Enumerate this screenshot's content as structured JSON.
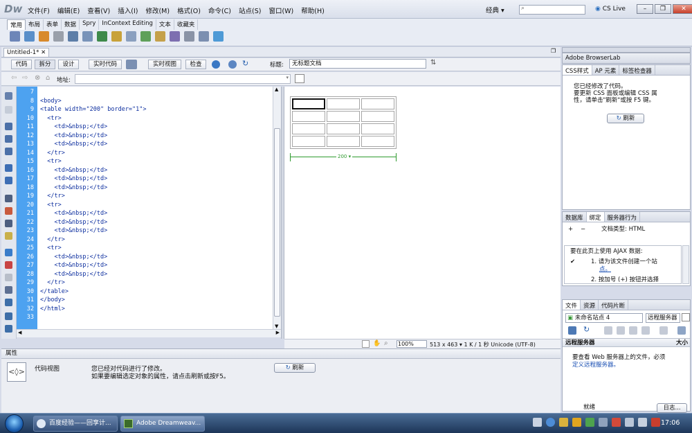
{
  "app": {
    "logo": "Dw",
    "menus": [
      "文件(F)",
      "编辑(E)",
      "查看(V)",
      "插入(I)",
      "修改(M)",
      "格式(O)",
      "命令(C)",
      "站点(S)",
      "窗口(W)",
      "帮助(H)"
    ],
    "workspace": "经典 ▾",
    "cslive": "CS Live"
  },
  "insert": {
    "tabs": [
      "常用",
      "布局",
      "表单",
      "数据",
      "Spry",
      "InContext Editing",
      "文本",
      "收藏夹"
    ]
  },
  "doc": {
    "tab": "Untitled-1*",
    "buttons": [
      "代码",
      "拆分",
      "设计",
      "实时代码",
      "实时视图",
      "检查"
    ],
    "title_label": "标题:",
    "title_value": "无标题文档",
    "address_label": "地址:"
  },
  "code": {
    "lines": [
      {
        "n": "7",
        "t": ""
      },
      {
        "n": "8",
        "t": "<body>"
      },
      {
        "n": "9",
        "t": "<table width=\"200\" border=\"1\">"
      },
      {
        "n": "10",
        "t": "  <tr>"
      },
      {
        "n": "11",
        "t": "    <td>&nbsp;</td>"
      },
      {
        "n": "12",
        "t": "    <td>&nbsp;</td>"
      },
      {
        "n": "13",
        "t": "    <td>&nbsp;</td>"
      },
      {
        "n": "14",
        "t": "  </tr>"
      },
      {
        "n": "15",
        "t": "  <tr>"
      },
      {
        "n": "16",
        "t": "    <td>&nbsp;</td>"
      },
      {
        "n": "17",
        "t": "    <td>&nbsp;</td>"
      },
      {
        "n": "18",
        "t": "    <td>&nbsp;</td>"
      },
      {
        "n": "19",
        "t": "  </tr>"
      },
      {
        "n": "20",
        "t": "  <tr>"
      },
      {
        "n": "21",
        "t": "    <td>&nbsp;</td>"
      },
      {
        "n": "22",
        "t": "    <td>&nbsp;</td>"
      },
      {
        "n": "23",
        "t": "    <td>&nbsp;</td>"
      },
      {
        "n": "24",
        "t": "  </tr>"
      },
      {
        "n": "25",
        "t": "  <tr>"
      },
      {
        "n": "26",
        "t": "    <td>&nbsp;</td>"
      },
      {
        "n": "27",
        "t": "    <td>&nbsp;</td>"
      },
      {
        "n": "28",
        "t": "    <td>&nbsp;</td>"
      },
      {
        "n": "29",
        "t": "  </tr>"
      },
      {
        "n": "30",
        "t": "</table>"
      },
      {
        "n": "31",
        "t": "</body>"
      },
      {
        "n": "32",
        "t": "</html>"
      },
      {
        "n": "33",
        "t": ""
      }
    ]
  },
  "design": {
    "width_label": "200 ▾"
  },
  "status": {
    "zoom": "100%",
    "dims": "513 x 463 ▾ 1 K / 1 秒 Unicode (UTF-8)"
  },
  "props": {
    "header": "属性",
    "icon": "<◊>",
    "label": "代码视图",
    "msg1": "您已经对代码进行了修改。",
    "msg2": "如果要编辑选定对象的属性，请点击刷新或按F5。",
    "refresh": "刷新"
  },
  "browserlab": {
    "title": "Adobe BrowserLab"
  },
  "css_panel": {
    "tabs": [
      "CSS样式",
      "AP 元素",
      "标签检查器"
    ],
    "msg1": "您已经修改了代码。",
    "msg2": "要更新 CSS 面板或编辑 CSS 属",
    "msg3": "性，请单击\"刷新\"或按 F5 键。",
    "refresh": "刷新"
  },
  "bind_panel": {
    "tabs": [
      "数据库",
      "绑定",
      "服务器行为"
    ],
    "doctype": "文档类型: HTML",
    "ajax": "要在此页上使用 AJAX 数据:",
    "step1": "1. 请为该文件创建一个站",
    "step1b": "点。",
    "step2": "2. 按加号 (+) 按钮并选择"
  },
  "files_panel": {
    "tabs": [
      "文件",
      "资源",
      "代码片断"
    ],
    "site": "未命名站点 4",
    "view": "远程服务器",
    "header": "远程服务器",
    "header2": "大小",
    "msg1": "要查看 Web 服务器上的文件，必须",
    "msg2": "定义远程服务器。",
    "ready": "就绪",
    "log": "日志..."
  },
  "taskbar": {
    "items": [
      "百度经验——回享计...",
      "Adobe Dreamweav..."
    ],
    "clock": "17:06"
  },
  "colors": {
    "line_gutter": "#4da2f0",
    "code_tag": "#0b2d9e",
    "width_ruler": "#2e9a2e"
  }
}
